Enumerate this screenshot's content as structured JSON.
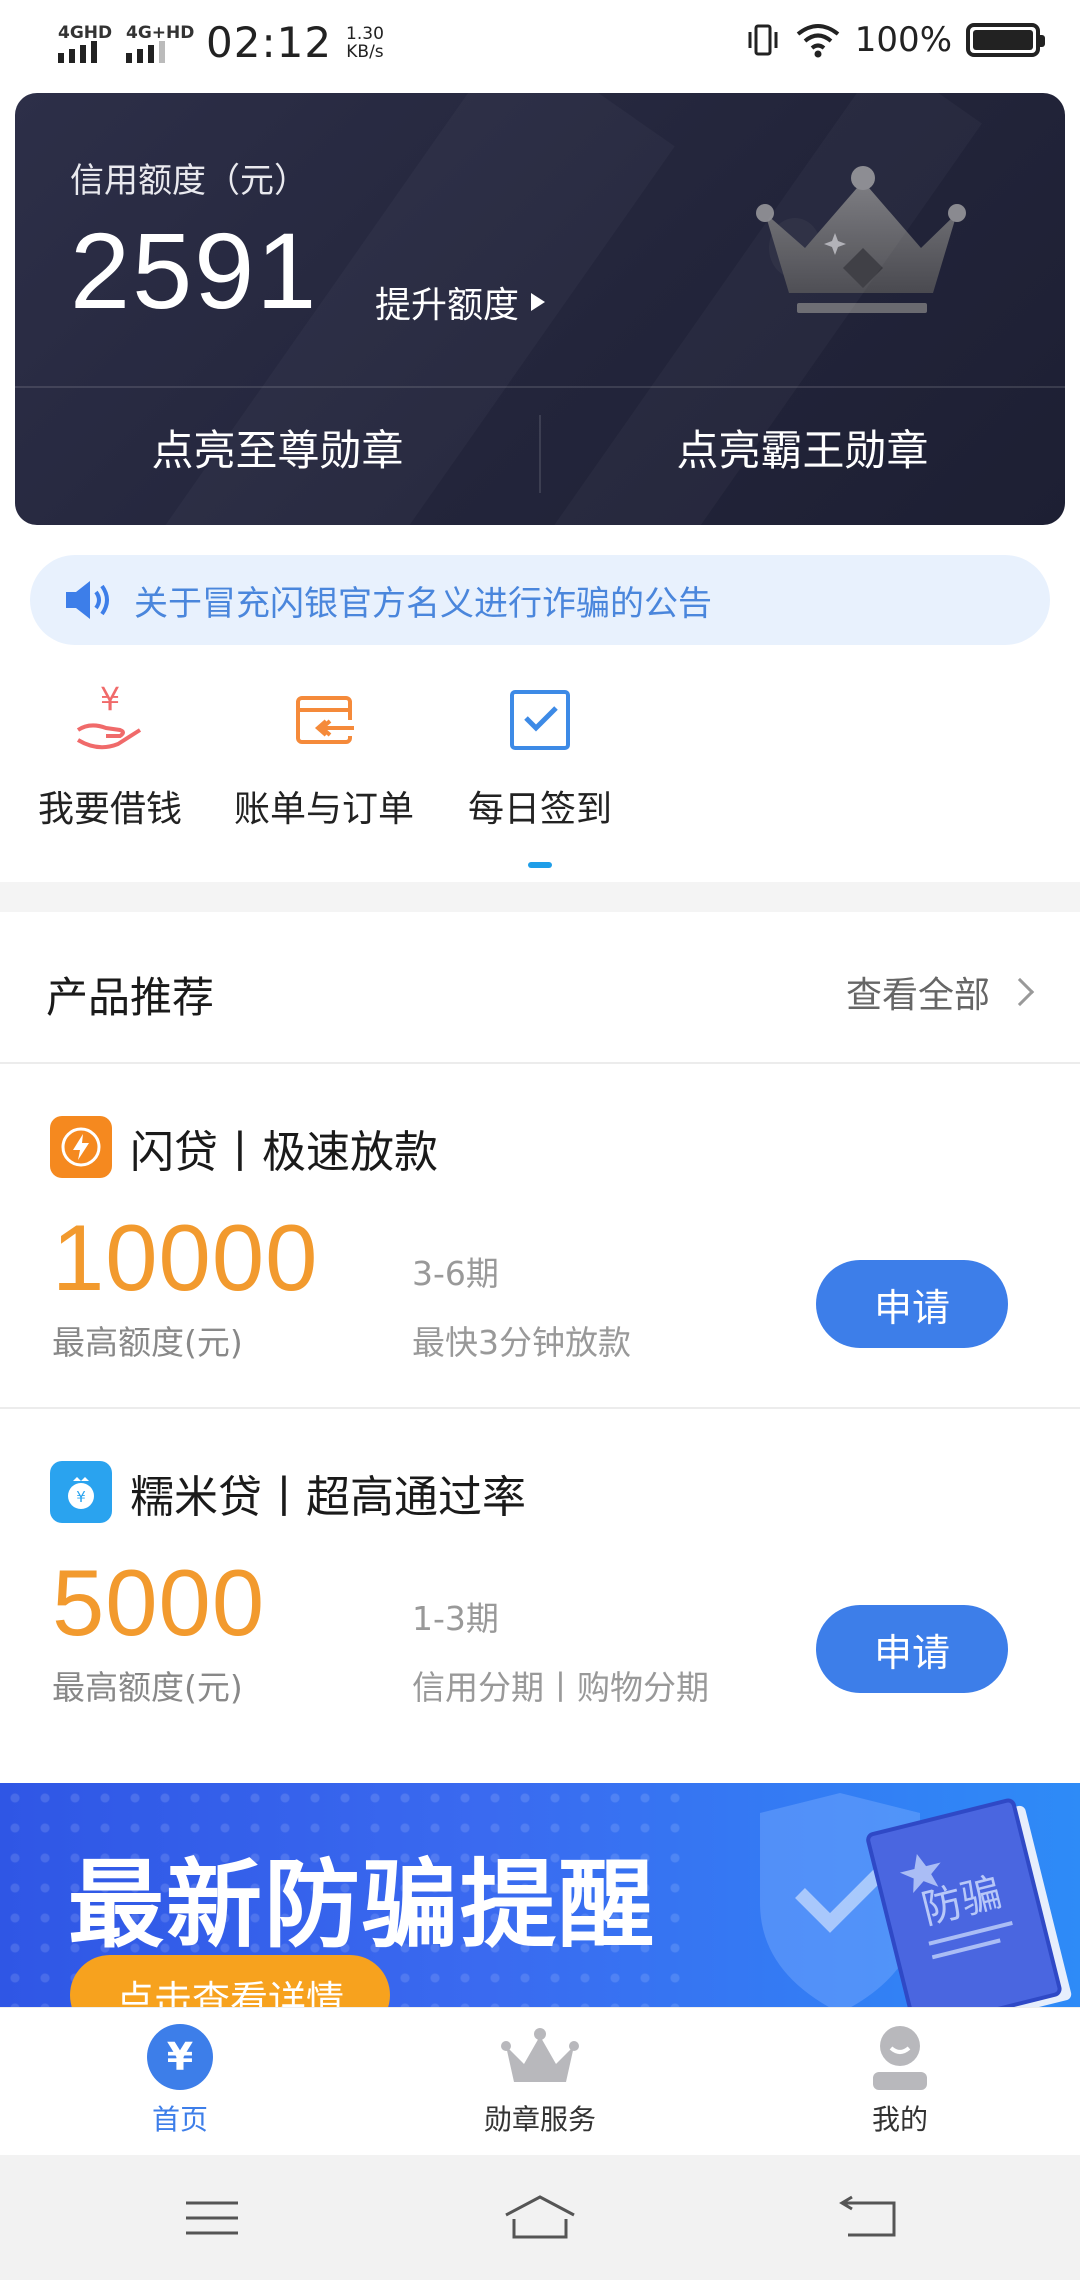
{
  "status_bar": {
    "network1": "4GHD",
    "network2": "4G+HD",
    "time": "02:12",
    "speed_value": "1.30",
    "speed_unit": "KB/s",
    "battery_percent": "100%"
  },
  "credit_card": {
    "title": "信用额度（元）",
    "amount": "2591",
    "raise_label": "提升额度",
    "badge_left": "点亮至尊勋章",
    "badge_right": "点亮霸王勋章"
  },
  "notice": {
    "text": "关于冒充闪银官方名义进行诈骗的公告"
  },
  "quick_actions": [
    {
      "label": "我要借钱",
      "icon": "borrow-money-icon"
    },
    {
      "label": "账单与订单",
      "icon": "bill-order-icon"
    },
    {
      "label": "每日签到",
      "icon": "daily-checkin-icon"
    }
  ],
  "products": {
    "section_title": "产品推荐",
    "view_all": "查看全部",
    "items": [
      {
        "name": "闪贷丨极速放款",
        "amount": "10000",
        "amount_label": "最高额度(元)",
        "term": "3-6期",
        "desc": "最快3分钟放款",
        "apply": "申请",
        "logo_color": "#f5891f"
      },
      {
        "name": "糯米贷丨超高通过率",
        "amount": "5000",
        "amount_label": "最高额度(元)",
        "term": "1-3期",
        "desc": "信用分期丨购物分期",
        "apply": "申请",
        "logo_color": "#2aa3ef"
      }
    ]
  },
  "banner": {
    "title": "最新防骗提醒",
    "button": "点击查看详情",
    "book_text": "防骗"
  },
  "bottom_nav": [
    {
      "label": "首页",
      "icon": "home-yen-icon",
      "active": true
    },
    {
      "label": "勋章服务",
      "icon": "crown-icon",
      "active": false
    },
    {
      "label": "我的",
      "icon": "profile-icon",
      "active": false
    }
  ],
  "colors": {
    "accent": "#3d7ee9",
    "amount_orange": "#f29a2e",
    "card_bg": "#26283e"
  }
}
